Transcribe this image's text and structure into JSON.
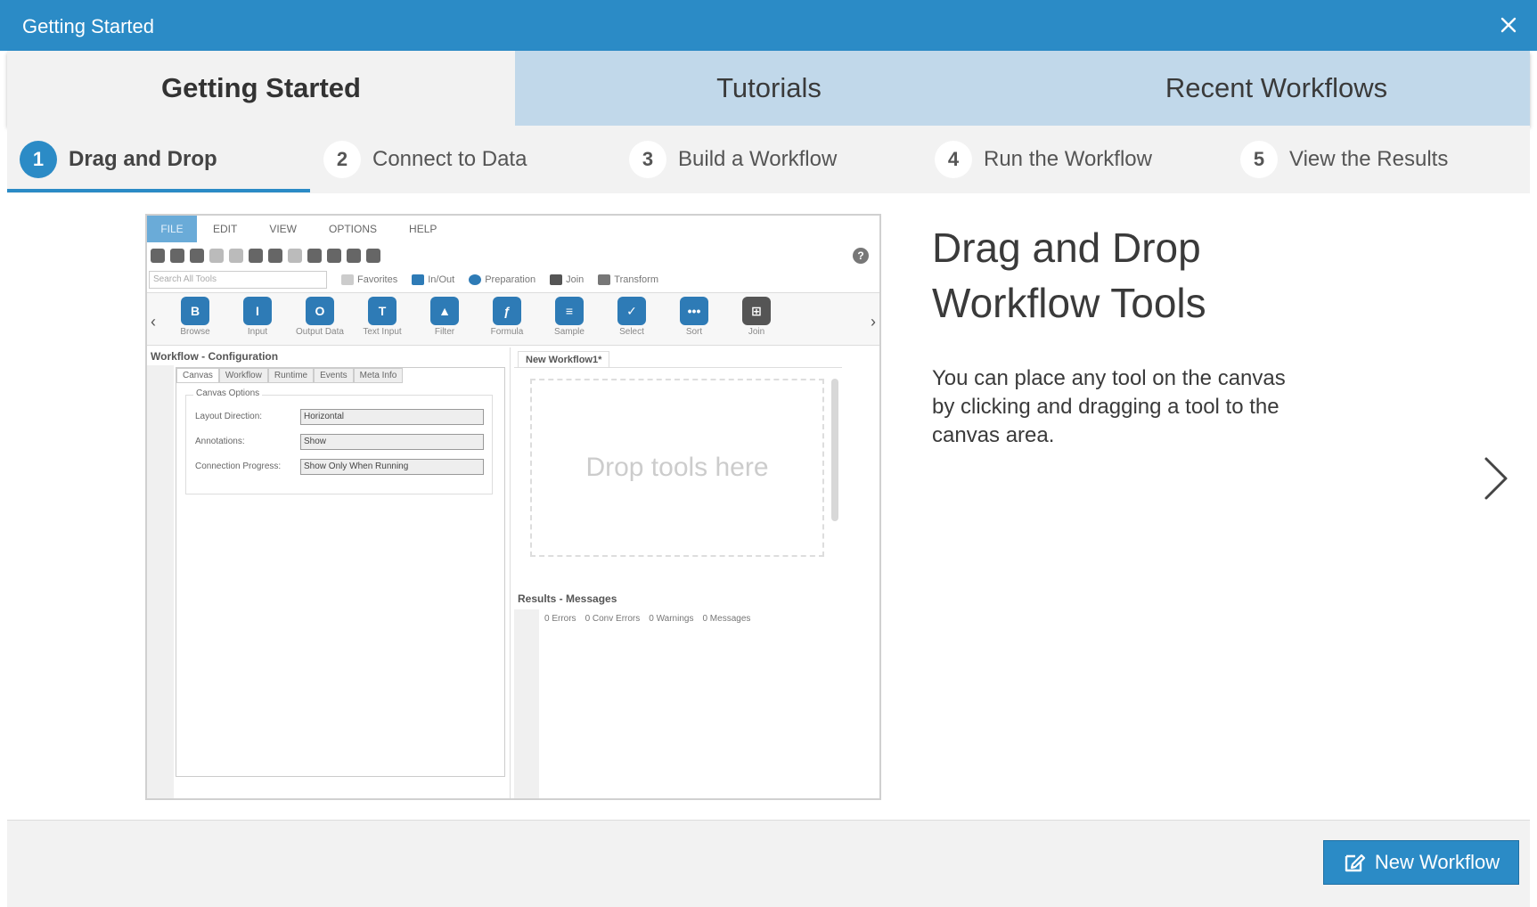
{
  "window": {
    "title": "Getting Started"
  },
  "tabs": [
    {
      "label": "Getting Started",
      "active": true
    },
    {
      "label": "Tutorials",
      "active": false
    },
    {
      "label": "Recent Workflows",
      "active": false
    }
  ],
  "steps": [
    {
      "num": "1",
      "label": "Drag and Drop",
      "active": true
    },
    {
      "num": "2",
      "label": "Connect to Data",
      "active": false
    },
    {
      "num": "3",
      "label": "Build a Workflow",
      "active": false
    },
    {
      "num": "4",
      "label": "Run the Workflow",
      "active": false
    },
    {
      "num": "5",
      "label": "View the Results",
      "active": false
    }
  ],
  "screenshot": {
    "menu": [
      "FILE",
      "EDIT",
      "VIEW",
      "OPTIONS",
      "HELP"
    ],
    "search_placeholder": "Search All Tools",
    "categories": [
      "Favorites",
      "In/Out",
      "Preparation",
      "Join",
      "Transform"
    ],
    "tools": [
      "Browse",
      "Input",
      "Output Data",
      "Text Input",
      "Filter",
      "Formula",
      "Sample",
      "Select",
      "Sort",
      "Join"
    ],
    "config_title": "Workflow - Configuration",
    "config_tabs": [
      "Canvas",
      "Workflow",
      "Runtime",
      "Events",
      "Meta Info"
    ],
    "canvas_options_label": "Canvas Options",
    "options": [
      {
        "label": "Layout Direction:",
        "value": "Horizontal"
      },
      {
        "label": "Annotations:",
        "value": "Show"
      },
      {
        "label": "Connection Progress:",
        "value": "Show Only When Running"
      }
    ],
    "workflow_tab": "New Workflow1*",
    "drop_text": "Drop tools here",
    "results_title": "Results - Messages",
    "results_stats": [
      "0 Errors",
      "0 Conv Errors",
      "0 Warnings",
      "0 Messages"
    ]
  },
  "content": {
    "headline_line1": "Drag and Drop",
    "headline_line2": "Workflow Tools",
    "description": "You can place any tool on the canvas by clicking and dragging a tool to the canvas area."
  },
  "footer": {
    "new_workflow_label": "New Workflow"
  },
  "colors": {
    "accent": "#2b8bc6",
    "tab_bar": "#c1d8ea",
    "panel": "#f2f2f2"
  }
}
